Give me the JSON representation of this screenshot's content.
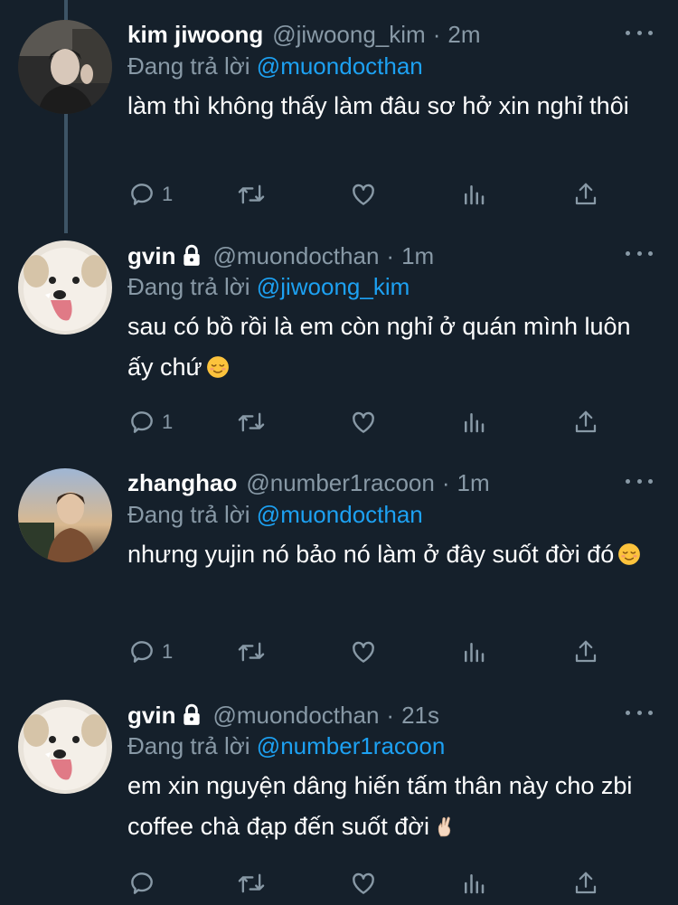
{
  "tweets": [
    {
      "name": "kim jiwoong",
      "handle": "@jiwoong_kim",
      "time": "2m",
      "locked": false,
      "reply_prefix": "Đang trả lời",
      "reply_mention": "@muondocthan",
      "text": "làm thì không thấy làm đâu sơ hở xin nghỉ thôi",
      "emoji": "",
      "reply_count": "1"
    },
    {
      "name": "gvin",
      "handle": "@muondocthan",
      "time": "1m",
      "locked": true,
      "reply_prefix": "Đang trả lời",
      "reply_mention": "@jiwoong_kim",
      "text": "sau có bồ rồi là em còn nghỉ ở quán mình luôn ấy chứ",
      "emoji": "relieved-face",
      "reply_count": "1"
    },
    {
      "name": "zhanghao",
      "handle": "@number1racoon",
      "time": "1m",
      "locked": false,
      "reply_prefix": "Đang trả lời",
      "reply_mention": "@muondocthan",
      "text": "nhưng yujin nó bảo nó làm ở đây suốt đời đó",
      "emoji": "relieved-face",
      "reply_count": "1"
    },
    {
      "name": "gvin",
      "handle": "@muondocthan",
      "time": "21s",
      "locked": true,
      "reply_prefix": "Đang trả lời",
      "reply_mention": "@number1racoon",
      "text": "em xin nguyện dâng hiến tấm thân này cho zbi coffee chà đạp đến suốt đời",
      "emoji": "crossed-fingers",
      "reply_count": ""
    }
  ],
  "separator": "·",
  "icons": [
    "reply-icon",
    "retweet-icon",
    "like-icon",
    "analytics-icon",
    "share-icon",
    "more-icon",
    "lock-icon"
  ],
  "colors": {
    "background": "#15202b",
    "text": "#ffffff",
    "secondary": "#8899a6",
    "mention": "#1da1f2",
    "thread_line": "#3d5466"
  }
}
